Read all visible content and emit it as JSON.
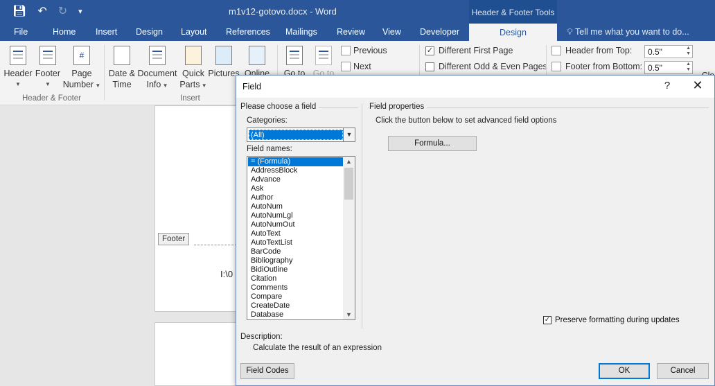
{
  "titlebar": {
    "doc_title": "m1v12-gotovo.docx - Word",
    "contextual_title": "Header & Footer Tools"
  },
  "tabs": [
    "File",
    "Home",
    "Insert",
    "Design",
    "Layout",
    "References",
    "Mailings",
    "Review",
    "View",
    "Developer"
  ],
  "active_tab": "Design",
  "tell_me": "Tell me what you want to do...",
  "ribbon": {
    "header_label": "Header",
    "footer_label": "Footer",
    "page_number_l1": "Page",
    "page_number_l2": "Number",
    "group_header_footer": "Header & Footer",
    "date_l1": "Date &",
    "date_l2": "Time",
    "docinfo_l1": "Document",
    "docinfo_l2": "Info",
    "quickparts_l1": "Quick",
    "quickparts_l2": "Parts",
    "pictures_label": "Pictures",
    "online_label": "Online",
    "group_insert": "Insert",
    "goto_label": "Go to",
    "goto2_label": "Go to",
    "previous_label": "Previous",
    "next_label": "Next",
    "different_first_page": "Different First Page",
    "different_odd_even": "Different Odd & Even Pages",
    "header_from_top": "Header from Top:",
    "header_from_top_value": "0.5\"",
    "footer_from_bottom": "Footer from Bottom:",
    "footer_from_bottom_value": "0.5\"",
    "close_partial": "Clo"
  },
  "document": {
    "footer_tag": "Footer",
    "fragment": "I:\\0"
  },
  "dialog": {
    "title": "Field",
    "help": "?",
    "close": "✕",
    "choose_field": "Please choose a field",
    "categories_label": "Categories:",
    "categories_value": "(All)",
    "field_names_label": "Field names:",
    "field_names": [
      "= (Formula)",
      "AddressBlock",
      "Advance",
      "Ask",
      "Author",
      "AutoNum",
      "AutoNumLgl",
      "AutoNumOut",
      "AutoText",
      "AutoTextList",
      "BarCode",
      "Bibliography",
      "BidiOutline",
      "Citation",
      "Comments",
      "Compare",
      "CreateDate",
      "Database"
    ],
    "selected_field": "= (Formula)",
    "field_properties": "Field properties",
    "properties_hint": "Click the button below to set advanced field options",
    "formula_button": "Formula...",
    "preserve_formatting": "Preserve formatting during updates",
    "description_label": "Description:",
    "description_text": "Calculate the result of an expression",
    "field_codes_button": "Field Codes",
    "ok_button": "OK",
    "cancel_button": "Cancel"
  }
}
